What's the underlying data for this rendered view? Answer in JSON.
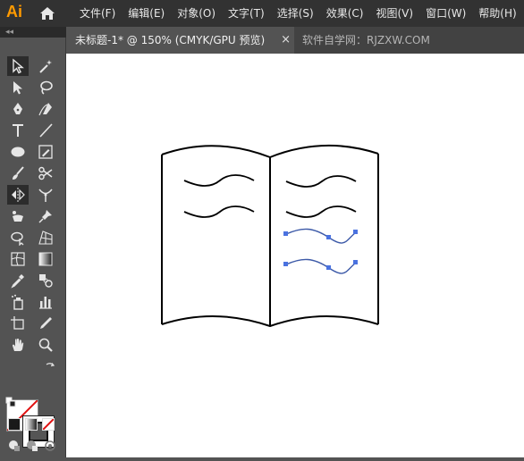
{
  "app": {
    "logo_text": "Ai",
    "brand_color": "#ff9a00"
  },
  "menu": {
    "items": [
      "文件(F)",
      "编辑(E)",
      "对象(O)",
      "文字(T)",
      "选择(S)",
      "效果(C)",
      "视图(V)",
      "窗口(W)",
      "帮助(H)"
    ]
  },
  "panel": {
    "collapse_glyph": "◂◂"
  },
  "tabs": {
    "active_label": "未标题-1* @ 150% (CMYK/GPU 预览)",
    "close_glyph": "×",
    "other_label": "软件自学网：RJZXW.COM"
  },
  "toolbar": {
    "tools": [
      "selection-tool-icon",
      "magic-wand-icon",
      "direct-selection-icon",
      "lasso-icon",
      "pen-tool-icon",
      "curvature-tool-icon",
      "type-tool-icon",
      "line-segment-icon",
      "ellipse-tool-icon",
      "pencil-tool-icon",
      "paintbrush-icon",
      "scissors-icon",
      "reflect-tool-icon",
      "width-tool-icon",
      "puppet-warp-icon",
      "pin-icon",
      "shape-builder-icon",
      "perspective-grid-icon",
      "mesh-tool-icon",
      "gradient-tool-icon",
      "eyedropper-icon",
      "blend-tool-icon",
      "symbol-sprayer-icon",
      "column-graph-icon",
      "artboard-tool-icon",
      "slice-tool-icon",
      "hand-tool-icon",
      "zoom-tool-icon"
    ]
  },
  "colors": {
    "canvas_bg": "#ffffff",
    "selected_path": "#3d5aa8",
    "anchor_point": "#4a72e0",
    "no_fill_slash": "#e01010"
  }
}
